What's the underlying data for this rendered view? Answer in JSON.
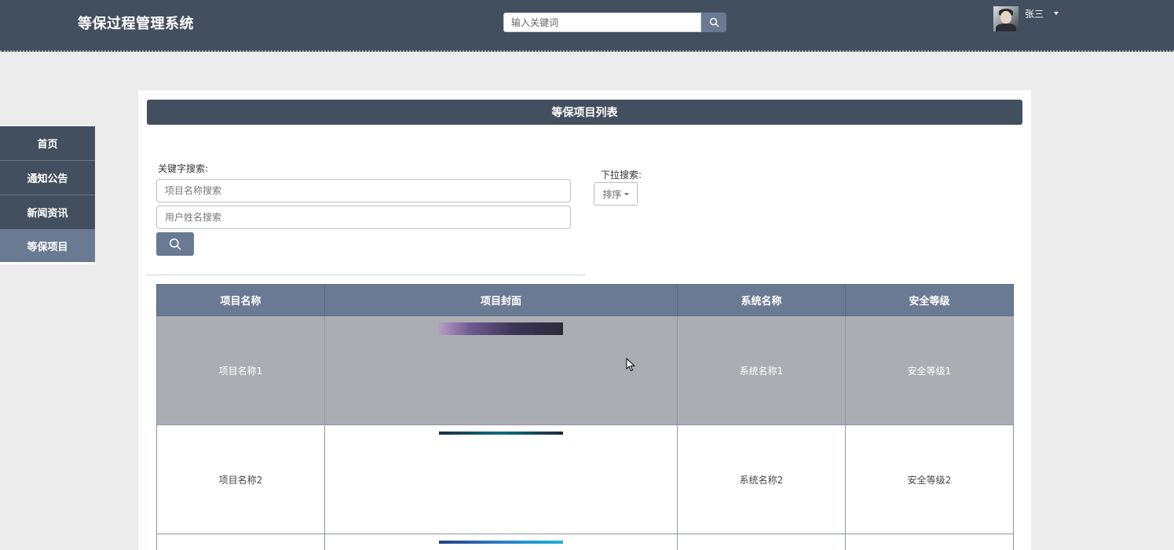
{
  "header": {
    "app_title": "等保过程管理系统",
    "search_placeholder": "输入关键词",
    "user_name": "张三"
  },
  "sidebar": {
    "items": [
      {
        "label": "首页",
        "active": false
      },
      {
        "label": "通知公告",
        "active": false
      },
      {
        "label": "新闻资讯",
        "active": false
      },
      {
        "label": "等保项目",
        "active": true
      }
    ]
  },
  "panel": {
    "title": "等保项目列表",
    "keyword_label": "关键字搜索:",
    "project_name_placeholder": "项目名称搜索",
    "user_name_placeholder": "用户姓名搜索",
    "dropdown_label": "下拉搜索:",
    "sort_label": "排序"
  },
  "table": {
    "columns": [
      "项目名称",
      "项目封面",
      "系统名称",
      "安全等级"
    ],
    "rows": [
      {
        "name": "项目名称1",
        "system": "系统名称1",
        "level": "安全等级1"
      },
      {
        "name": "项目名称2",
        "system": "系统名称2",
        "level": "安全等级2"
      }
    ]
  },
  "colors": {
    "header_bg": "#434f5e",
    "accent": "#6b7a93",
    "row_highlight": "#acadb2",
    "page_bg": "#ececec"
  }
}
